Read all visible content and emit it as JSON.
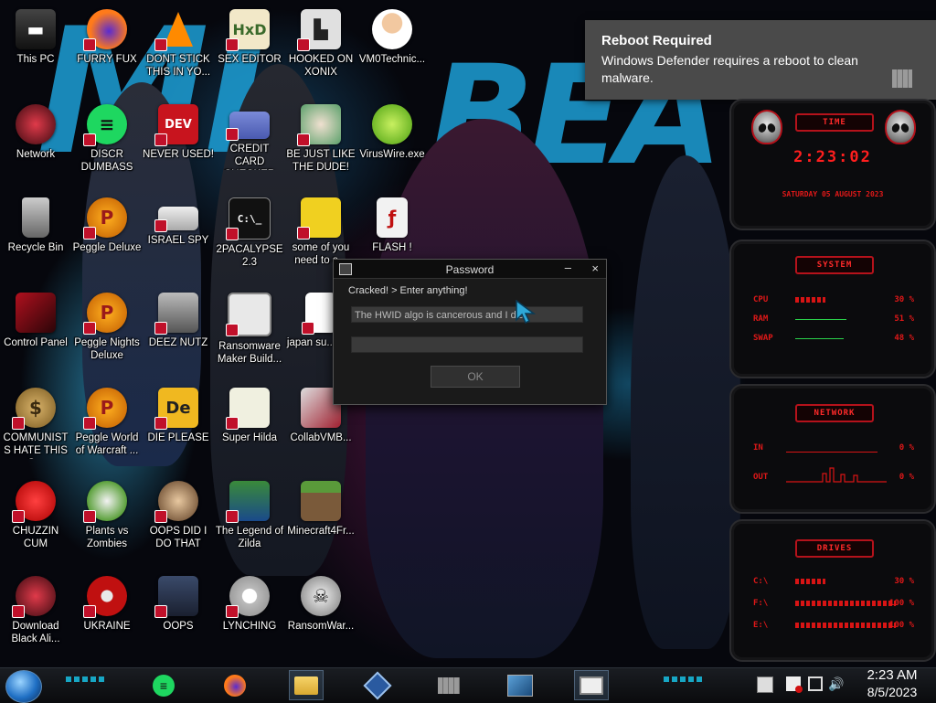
{
  "desktop": {
    "icons": [
      {
        "label": "This PC"
      },
      {
        "label": "FURRY FUX"
      },
      {
        "label": "DONT STICK THIS IN YO..."
      },
      {
        "label": "SEX EDITOR"
      },
      {
        "label": "HOOKED ON XONIX"
      },
      {
        "label": "VM0Technic..."
      },
      {
        "label": "Network"
      },
      {
        "label": "DISCR DUMBASS"
      },
      {
        "label": "NEVER USED!"
      },
      {
        "label": "CREDIT CARD CHECKER"
      },
      {
        "label": "BE JUST LIKE THE DUDE!"
      },
      {
        "label": "VirusWire.exe"
      },
      {
        "label": "Recycle Bin"
      },
      {
        "label": "Peggle Deluxe"
      },
      {
        "label": "ISRAEL SPY"
      },
      {
        "label": "2PACALYPSE 2.3"
      },
      {
        "label": "some of you need to a..."
      },
      {
        "label": "FLASH !"
      },
      {
        "label": "Control Panel"
      },
      {
        "label": "Peggle Nights Deluxe"
      },
      {
        "label": "DEEZ NUTZ"
      },
      {
        "label": "Ransomware Maker Build..."
      },
      {
        "label": "japan su... sim"
      },
      {
        "label": "COMMUNISTS HATE THIS G..."
      },
      {
        "label": "Peggle World of Warcraft ..."
      },
      {
        "label": "DIE PLEASE"
      },
      {
        "label": "Super Hilda"
      },
      {
        "label": "CollabVMB..."
      },
      {
        "label": "CHUZZIN CUM"
      },
      {
        "label": "Plants vs Zombies"
      },
      {
        "label": "OOPS DID I DO THAT"
      },
      {
        "label": "The Legend of Zilda"
      },
      {
        "label": "Minecraft4Fr..."
      },
      {
        "label": "Download Black Ali..."
      },
      {
        "label": "UKRAINE"
      },
      {
        "label": "OOPS"
      },
      {
        "label": "LYNCHING"
      },
      {
        "label": "RansomWar..."
      }
    ]
  },
  "toast": {
    "title": "Reboot Required",
    "body": "Windows Defender requires a reboot to clean malware."
  },
  "dialog": {
    "title": "Password",
    "minimize": "–",
    "close": "×",
    "prompt": "Cracked! > Enter anything!",
    "field1_value": "The HWID algo is cancerous and I dis",
    "field2_value": "",
    "ok_label": "OK"
  },
  "widgets": {
    "time": {
      "header": "TIME",
      "clock": "2:23:02",
      "date": "SATURDAY 05 AUGUST 2023"
    },
    "system": {
      "header": "SYSTEM",
      "rows": [
        {
          "label": "CPU",
          "value": "30 %",
          "fraction": 0.3
        },
        {
          "label": "RAM",
          "value": "51 %",
          "fraction": 0.51
        },
        {
          "label": "SWAP",
          "value": "48 %",
          "fraction": 0.48
        }
      ]
    },
    "network": {
      "header": "NETWORK",
      "rows": [
        {
          "label": "IN",
          "value": "0 %"
        },
        {
          "label": "OUT",
          "value": "0 %"
        }
      ]
    },
    "drives": {
      "header": "DRIVES",
      "rows": [
        {
          "label": "C:\\",
          "value": "30 %",
          "fraction": 0.3
        },
        {
          "label": "F:\\",
          "value": "100 %",
          "fraction": 1.0
        },
        {
          "label": "E:\\",
          "value": "100 %",
          "fraction": 1.0
        }
      ]
    }
  },
  "taskbar": {
    "clock_time": "2:23 AM",
    "clock_date": "8/5/2023"
  },
  "colors": {
    "widget_red": "#d81414",
    "accent_cyan": "#17a6c4",
    "toast_bg": "#4a4a4a"
  }
}
